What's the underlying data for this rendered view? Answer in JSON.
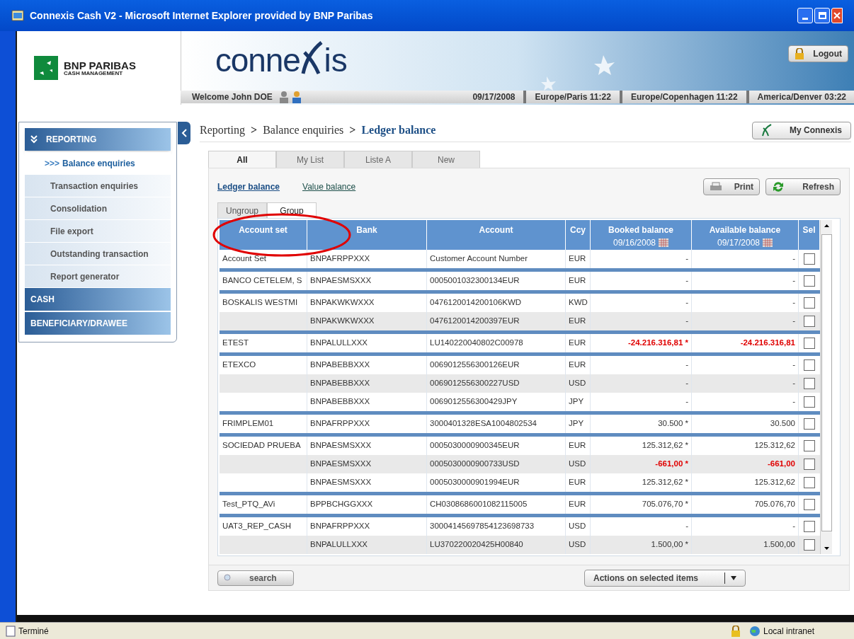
{
  "window": {
    "title": "Connexis Cash V2 - Microsoft Internet Explorer provided by BNP Paribas"
  },
  "header": {
    "bank_name": "BNP PARIBAS",
    "bank_sub": "CASH MANAGEMENT",
    "app_logo_left": "conne",
    "app_logo_right": "is",
    "logout": "Logout",
    "welcome": "Welcome John DOE",
    "date": "09/17/2008",
    "clocks": [
      "Europe/Paris 11:22",
      "Europe/Copenhagen 11:22",
      "America/Denver 03:22"
    ]
  },
  "sidebar": {
    "sections": [
      {
        "label": "REPORTING",
        "expanded": true,
        "items": [
          {
            "label": "Balance enquiries",
            "marker": ">>>",
            "selected": true
          },
          {
            "label": "Transaction enquiries",
            "selected": false
          },
          {
            "label": "Consolidation",
            "selected": false
          },
          {
            "label": "File export",
            "selected": false
          },
          {
            "label": "Outstanding transaction",
            "selected": false
          },
          {
            "label": "Report generator",
            "selected": false
          }
        ]
      },
      {
        "label": "CASH",
        "expanded": false
      },
      {
        "label": "BENEFICIARY/DRAWEE",
        "expanded": false
      }
    ]
  },
  "breadcrumb": [
    {
      "label": "Reporting",
      "current": false
    },
    {
      "label": "Balance enquiries",
      "current": false
    },
    {
      "label": "Ledger balance",
      "current": true
    }
  ],
  "breadcrumb_separator": ">",
  "my_connexis": "My Connexis",
  "tabs": [
    {
      "label": "All",
      "selected": true
    },
    {
      "label": "My List",
      "selected": false
    },
    {
      "label": "Liste A",
      "selected": false
    },
    {
      "label": "New",
      "selected": false
    }
  ],
  "views": [
    {
      "label": "Ledger balance",
      "selected": true
    },
    {
      "label": "Value balance",
      "selected": false
    }
  ],
  "buttons": {
    "print": "Print",
    "refresh": "Refresh"
  },
  "group_tabs": [
    {
      "label": "Ungroup",
      "selected": false
    },
    {
      "label": "Group",
      "selected": true
    }
  ],
  "table": {
    "columns": [
      {
        "label": "Account set"
      },
      {
        "label": "Bank"
      },
      {
        "label": "Account"
      },
      {
        "label": "Ccy"
      },
      {
        "label": "Booked balance",
        "date": "09/16/2008"
      },
      {
        "label": "Available balance",
        "date": "09/17/2008"
      },
      {
        "label": "Sel"
      }
    ],
    "groups": [
      {
        "account_set": "Account Set",
        "rows": [
          {
            "bank": "BNPAFRPPXXX",
            "account": "Customer Account Number",
            "ccy": "EUR",
            "booked": "-",
            "available": "-",
            "negative": false,
            "checked": false
          }
        ]
      },
      {
        "account_set": "BANCO CETELEM, S",
        "rows": [
          {
            "bank": "BNPAESMSXXX",
            "account": "0005001032300134EUR",
            "ccy": "EUR",
            "booked": "-",
            "available": "-",
            "negative": false,
            "checked": false
          }
        ]
      },
      {
        "account_set": "BOSKALIS WESTMI",
        "rows": [
          {
            "bank": "BNPAKWKWXXX",
            "account": "0476120014200106KWD",
            "ccy": "KWD",
            "booked": "-",
            "available": "-",
            "negative": false,
            "checked": false
          },
          {
            "bank": "BNPAKWKWXXX",
            "account": "0476120014200397EUR",
            "ccy": "EUR",
            "booked": "-",
            "available": "-",
            "negative": false,
            "checked": false
          }
        ]
      },
      {
        "account_set": "ETEST",
        "rows": [
          {
            "bank": "BNPALULLXXX",
            "account": "LU140220040802C00978",
            "ccy": "EUR",
            "booked": "-24.216.316,81 *",
            "available": "-24.216.316,81",
            "negative": true,
            "checked": false
          }
        ]
      },
      {
        "account_set": "ETEXCO",
        "rows": [
          {
            "bank": "BNPABEBBXXX",
            "account": "0069012556300126EUR",
            "ccy": "EUR",
            "booked": "-",
            "available": "-",
            "negative": false,
            "checked": false
          },
          {
            "bank": "BNPABEBBXXX",
            "account": "0069012556300227USD",
            "ccy": "USD",
            "booked": "-",
            "available": "-",
            "negative": false,
            "checked": false
          },
          {
            "bank": "BNPABEBBXXX",
            "account": "0069012556300429JPY",
            "ccy": "JPY",
            "booked": "-",
            "available": "-",
            "negative": false,
            "checked": false
          }
        ]
      },
      {
        "account_set": "FRIMPLEM01",
        "rows": [
          {
            "bank": "BNPAFRPPXXX",
            "account": "3000401328ESA1004802534",
            "ccy": "JPY",
            "booked": "30.500 *",
            "available": "30.500",
            "negative": false,
            "checked": false
          }
        ]
      },
      {
        "account_set": "SOCIEDAD PRUEBA",
        "rows": [
          {
            "bank": "BNPAESMSXXX",
            "account": "0005030000900345EUR",
            "ccy": "EUR",
            "booked": "125.312,62 *",
            "available": "125.312,62",
            "negative": false,
            "checked": false
          },
          {
            "bank": "BNPAESMSXXX",
            "account": "0005030000900733USD",
            "ccy": "USD",
            "booked": "-661,00 *",
            "available": "-661,00",
            "negative": true,
            "checked": false
          },
          {
            "bank": "BNPAESMSXXX",
            "account": "0005030000901994EUR",
            "ccy": "EUR",
            "booked": "125.312,62 *",
            "available": "125.312,62",
            "negative": false,
            "checked": false
          }
        ]
      },
      {
        "account_set": "Test_PTQ_AVi",
        "rows": [
          {
            "bank": "BPPBCHGGXXX",
            "account": "CH0308686001082115005",
            "ccy": "EUR",
            "booked": "705.076,70 *",
            "available": "705.076,70",
            "negative": false,
            "checked": false
          }
        ]
      },
      {
        "account_set": "UAT3_REP_CASH",
        "rows": [
          {
            "bank": "BNPAFRPPXXX",
            "account": "30004145697854123698733",
            "ccy": "USD",
            "booked": "-",
            "available": "-",
            "negative": false,
            "checked": false
          },
          {
            "bank": "BNPALULLXXX",
            "account": "LU370220020425H00840",
            "ccy": "USD",
            "booked": "1.500,00 *",
            "available": "1.500,00",
            "negative": false,
            "checked": false
          }
        ]
      }
    ]
  },
  "footer": {
    "search": "search",
    "actions": "Actions on selected items"
  },
  "status_bar": {
    "status": "Terminé",
    "zone": "Local intranet"
  }
}
